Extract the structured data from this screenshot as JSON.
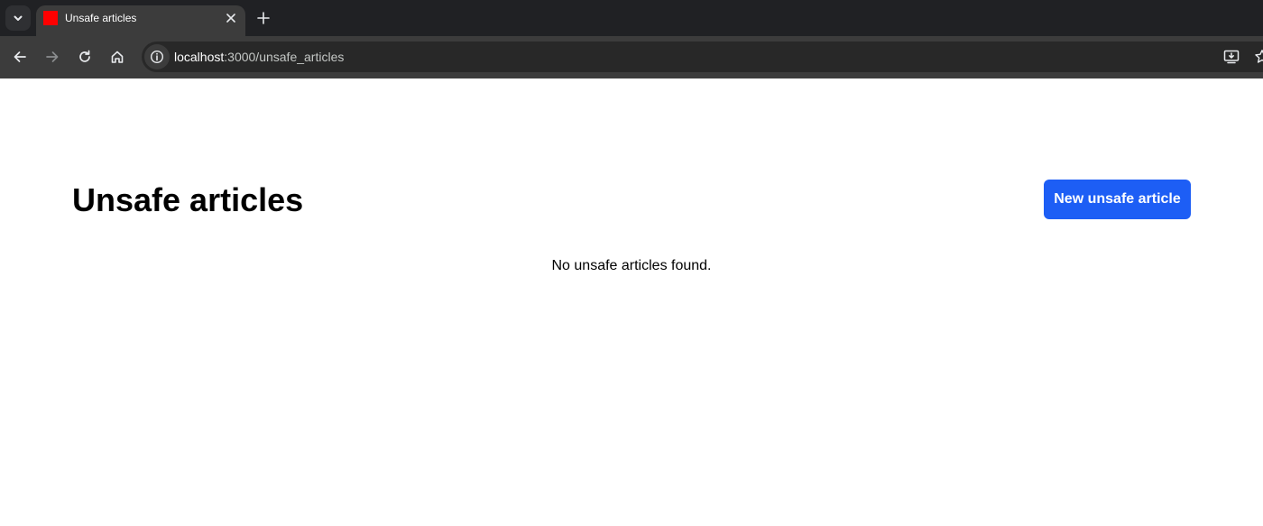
{
  "browser": {
    "tab": {
      "title": "Unsafe articles",
      "favicon_color": "#ff0000"
    },
    "address_bar": {
      "host": "localhost",
      "rest": ":3000/unsafe_articles"
    },
    "icons": {
      "tab_search": "chevron-down-icon",
      "tab_close": "close-icon",
      "new_tab": "plus-icon",
      "back": "arrow-left-icon",
      "forward": "arrow-right-icon",
      "reload": "reload-icon",
      "home": "home-icon",
      "site_info": "info-icon",
      "install": "install-icon",
      "bookmark": "star-icon"
    }
  },
  "page": {
    "title": "Unsafe articles",
    "new_button_label": "New unsafe article",
    "empty_message": "No unsafe articles found."
  },
  "colors": {
    "primary_button": "#1d5ef5",
    "chrome_dark": "#202124",
    "chrome_toolbar": "#3c3c3c"
  }
}
